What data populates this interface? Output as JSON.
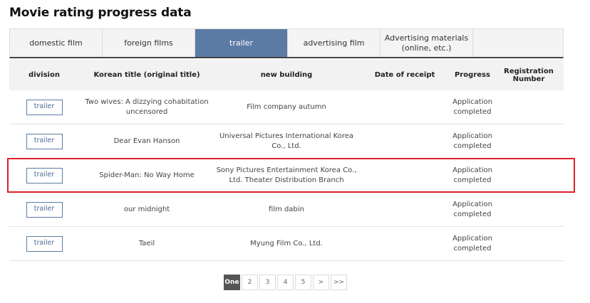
{
  "page_title": "Movie rating progress data",
  "tabs": [
    {
      "label": "domestic film"
    },
    {
      "label": "foreign films"
    },
    {
      "label": "trailer"
    },
    {
      "label": "advertising film"
    },
    {
      "label": "Advertising materials (online, etc.)"
    },
    {
      "label": ""
    }
  ],
  "active_tab": "trailer",
  "table": {
    "headers": {
      "division": "division",
      "title": "Korean title (original title)",
      "building": "new building",
      "date": "Date of receipt",
      "progress": "Progress",
      "regnum": "Registration Number"
    },
    "rows": [
      {
        "division": "trailer",
        "title": "Two wives: A dizzying cohabitation uncensored",
        "building": "Film company autumn",
        "date": "",
        "progress": "Application completed",
        "regnum": ""
      },
      {
        "division": "trailer",
        "title": "Dear Evan Hanson",
        "building": "Universal Pictures International Korea Co., Ltd.",
        "date": "",
        "progress": "Application completed",
        "regnum": ""
      },
      {
        "division": "trailer",
        "title": "Spider-Man: No Way Home",
        "building": "Sony Pictures Entertainment Korea Co., Ltd. Theater Distribution Branch",
        "date": "",
        "progress": "Application completed",
        "regnum": ""
      },
      {
        "division": "trailer",
        "title": "our midnight",
        "building": "film dabin",
        "date": "",
        "progress": "Application completed",
        "regnum": ""
      },
      {
        "division": "trailer",
        "title": "Taeil",
        "building": "Myung Film Co., Ltd.",
        "date": "",
        "progress": "Application completed",
        "regnum": ""
      }
    ],
    "highlighted_row": 2,
    "highlight_color": "#e0202a"
  },
  "pagination": {
    "pages": [
      "One",
      "2",
      "3",
      "4",
      "5",
      ">",
      ">>"
    ],
    "active": "One"
  },
  "colors": {
    "accent": "#5b7ba4"
  }
}
